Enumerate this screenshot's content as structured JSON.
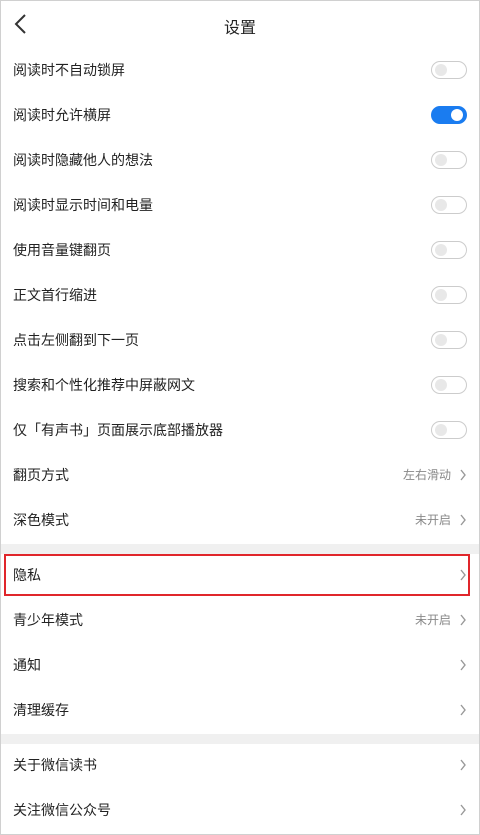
{
  "header": {
    "title": "设置"
  },
  "toggles": [
    {
      "label": "阅读时不自动锁屏",
      "on": false
    },
    {
      "label": "阅读时允许横屏",
      "on": true
    },
    {
      "label": "阅读时隐藏他人的想法",
      "on": false
    },
    {
      "label": "阅读时显示时间和电量",
      "on": false
    },
    {
      "label": "使用音量键翻页",
      "on": false
    },
    {
      "label": "正文首行缩进",
      "on": false
    },
    {
      "label": "点击左侧翻到下一页",
      "on": false
    },
    {
      "label": "搜索和个性化推荐中屏蔽网文",
      "on": false
    },
    {
      "label": "仅「有声书」页面展示底部播放器",
      "on": false
    }
  ],
  "nav_group1": [
    {
      "label": "翻页方式",
      "value": "左右滑动"
    },
    {
      "label": "深色模式",
      "value": "未开启"
    }
  ],
  "nav_group2": [
    {
      "label": "隐私",
      "value": ""
    },
    {
      "label": "青少年模式",
      "value": "未开启"
    },
    {
      "label": "通知",
      "value": ""
    },
    {
      "label": "清理缓存",
      "value": ""
    }
  ],
  "nav_group3": [
    {
      "label": "关于微信读书",
      "value": ""
    },
    {
      "label": "关注微信公众号",
      "value": ""
    }
  ],
  "colors": {
    "accent": "#1a7cf0",
    "highlight": "#e0262b",
    "divider": "#f0f0f0"
  }
}
